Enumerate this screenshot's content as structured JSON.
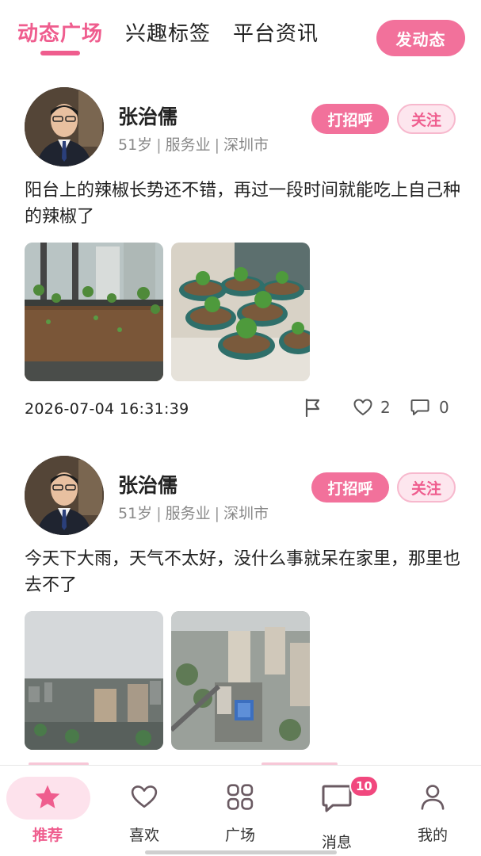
{
  "header": {
    "tabs": [
      {
        "label": "动态广场",
        "active": true
      },
      {
        "label": "兴趣标签",
        "active": false
      },
      {
        "label": "平台资讯",
        "active": false
      }
    ],
    "post_button": "发动态"
  },
  "posts": [
    {
      "name": "张治儒",
      "age": "51岁",
      "industry": "服务业",
      "city": "深圳市",
      "greet_label": "打招呼",
      "follow_label": "关注",
      "content": "阳台上的辣椒长势还不错，再过一段时间就能吃上自己种的辣椒了",
      "photos": [
        "balcony-planter-chili-photo",
        "potted-chili-plants-photo"
      ],
      "time": "2026-07-04 16:31:39",
      "likes": "2",
      "comments": "0"
    },
    {
      "name": "张治儒",
      "age": "51岁",
      "industry": "服务业",
      "city": "深圳市",
      "greet_label": "打招呼",
      "follow_label": "关注",
      "content": "今天下大雨，天气不太好，没什么事就呆在家里，那里也去不了",
      "photos": [
        "cloudy-city-skyline-photo",
        "city-aerial-view-photo"
      ]
    }
  ],
  "bottom_nav": {
    "items": [
      {
        "label": "推荐",
        "icon": "star-icon",
        "active": true
      },
      {
        "label": "喜欢",
        "icon": "heart-icon",
        "active": false
      },
      {
        "label": "广场",
        "icon": "grid-icon",
        "active": false
      },
      {
        "label": "消息",
        "icon": "message-icon",
        "active": false,
        "badge": "10"
      },
      {
        "label": "我的",
        "icon": "user-icon",
        "active": false
      }
    ]
  },
  "colors": {
    "accent": "#ef5d8e",
    "button": "#f2719b",
    "badge": "#f1487e"
  }
}
